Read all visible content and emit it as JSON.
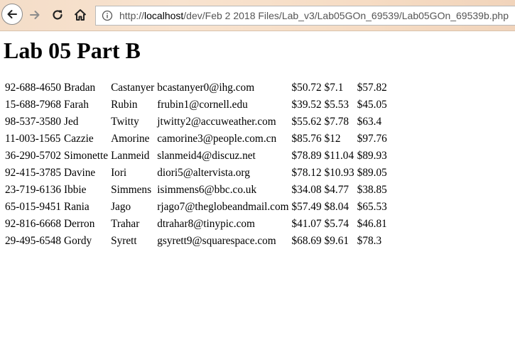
{
  "browser": {
    "url_prefix": "http://",
    "url_host": "localhost",
    "url_path": "/dev/Feb 2 2018 Files/Lab_v3/Lab05GOn_69539/Lab05GOn_69539b.php",
    "icons": {
      "back": "back-arrow-icon",
      "forward": "forward-arrow-icon",
      "reload": "reload-icon",
      "home": "home-icon",
      "info": "info-icon"
    }
  },
  "page": {
    "title": "Lab 05 Part B"
  },
  "rows": [
    {
      "phone": "92-688-4650",
      "first": "Bradan",
      "last": "Castanyer",
      "email": "bcastanyer0@ihg.com",
      "amount": "$50.72",
      "tax": "$7.1",
      "total": "$57.82"
    },
    {
      "phone": "15-688-7968",
      "first": "Farah",
      "last": "Rubin",
      "email": "frubin1@cornell.edu",
      "amount": "$39.52",
      "tax": "$5.53",
      "total": "$45.05"
    },
    {
      "phone": "98-537-3580",
      "first": "Jed",
      "last": "Twitty",
      "email": "jtwitty2@accuweather.com",
      "amount": "$55.62",
      "tax": "$7.78",
      "total": "$63.4"
    },
    {
      "phone": "11-003-1565",
      "first": "Cazzie",
      "last": "Amorine",
      "email": "camorine3@people.com.cn",
      "amount": "$85.76",
      "tax": "$12",
      "total": "$97.76"
    },
    {
      "phone": "36-290-5702",
      "first": "Simonette",
      "last": "Lanmeid",
      "email": "slanmeid4@discuz.net",
      "amount": "$78.89",
      "tax": "$11.04",
      "total": "$89.93"
    },
    {
      "phone": "92-415-3785",
      "first": "Davine",
      "last": "Iori",
      "email": "diori5@altervista.org",
      "amount": "$78.12",
      "tax": "$10.93",
      "total": "$89.05"
    },
    {
      "phone": "23-719-6136",
      "first": "Ibbie",
      "last": "Simmens",
      "email": "isimmens6@bbc.co.uk",
      "amount": "$34.08",
      "tax": "$4.77",
      "total": "$38.85"
    },
    {
      "phone": "65-015-9451",
      "first": "Rania",
      "last": "Jago",
      "email": "rjago7@theglobeandmail.com",
      "amount": "$57.49",
      "tax": "$8.04",
      "total": "$65.53"
    },
    {
      "phone": "92-816-6668",
      "first": "Derron",
      "last": "Trahar",
      "email": "dtrahar8@tinypic.com",
      "amount": "$41.07",
      "tax": "$5.74",
      "total": "$46.81"
    },
    {
      "phone": "29-495-6548",
      "first": "Gordy",
      "last": "Syrett",
      "email": "gsyrett9@squarespace.com",
      "amount": "$68.69",
      "tax": "$9.61",
      "total": "$78.3"
    }
  ]
}
